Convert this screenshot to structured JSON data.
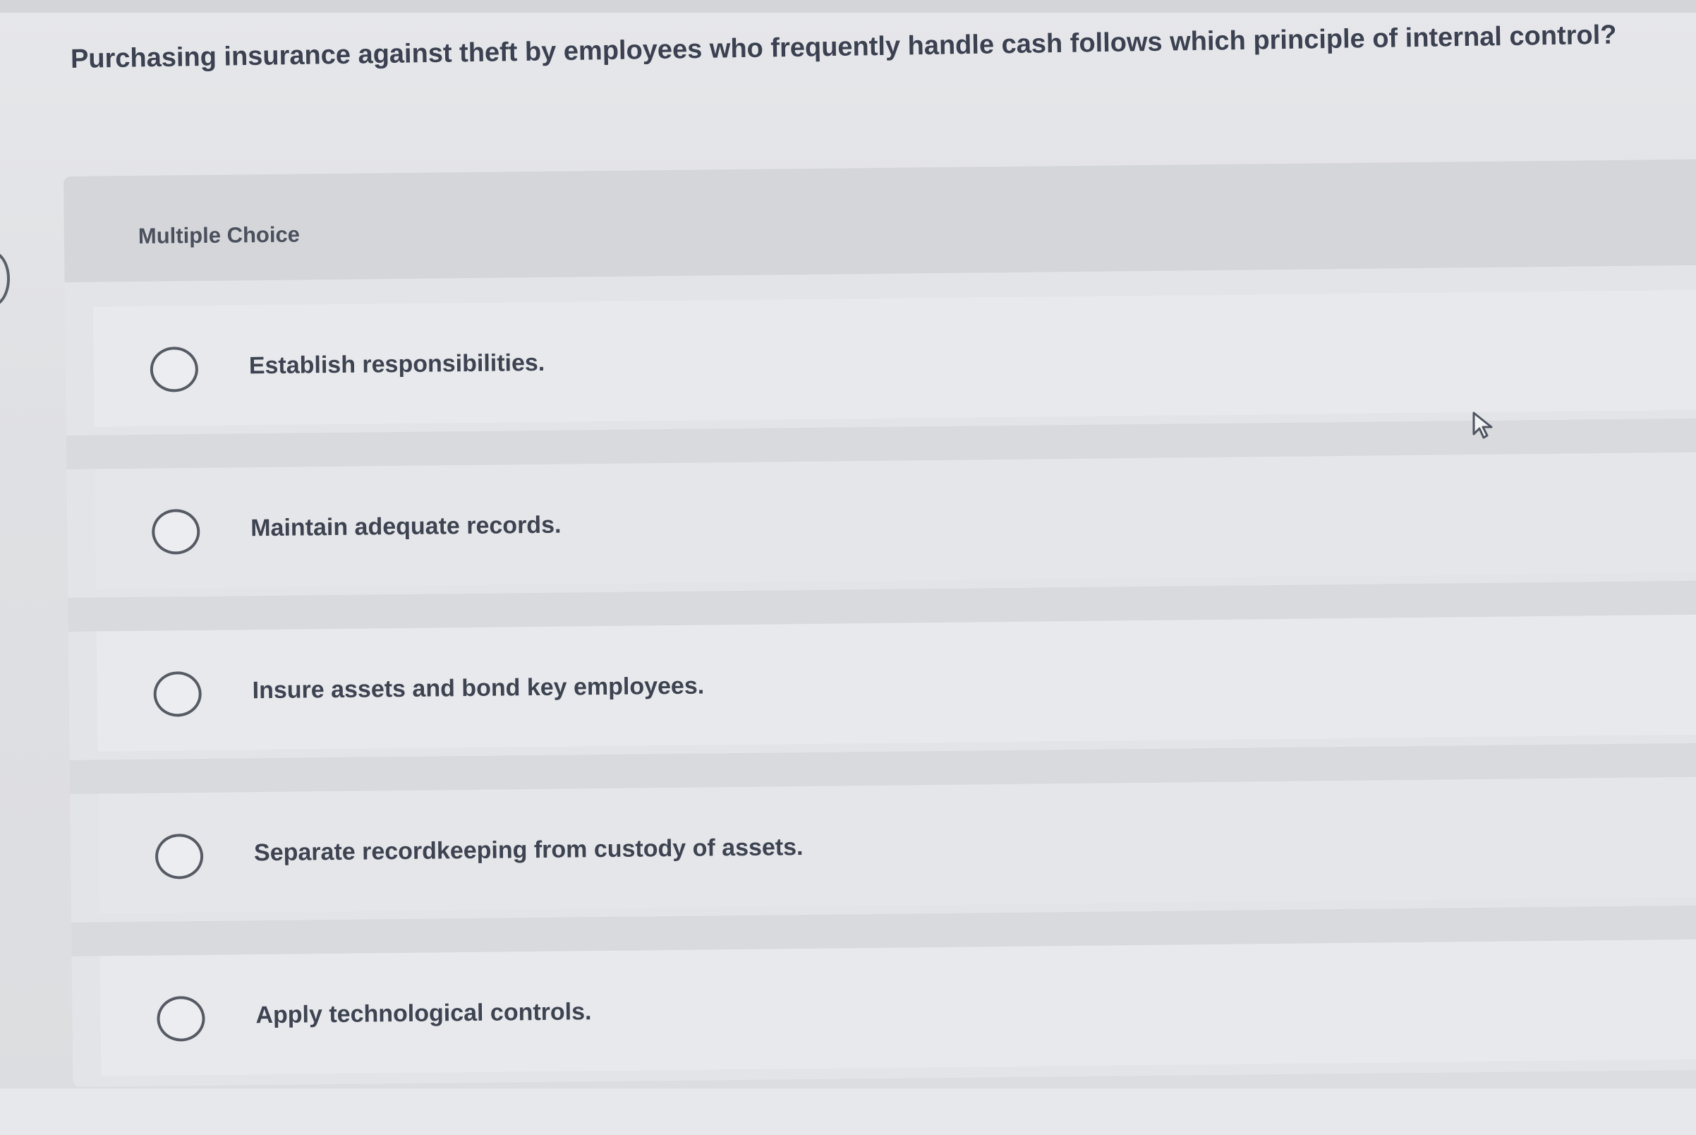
{
  "question": {
    "text": "Purchasing insurance against theft by employees who frequently handle cash follows which principle of internal control?"
  },
  "question_type": {
    "label": "Multiple Choice"
  },
  "choices": [
    {
      "label": "Establish responsibilities."
    },
    {
      "label": "Maintain adequate records."
    },
    {
      "label": "Insure assets and bond key employees."
    },
    {
      "label": "Separate recordkeeping from custody of assets."
    },
    {
      "label": "Apply technological controls."
    }
  ],
  "icons": {
    "radio": "radio-unselected-icon",
    "cursor": "mouse-pointer-icon"
  },
  "colors": {
    "text": "#3b4150",
    "card": "#e3e4e7",
    "header": "#d5d6da",
    "radio_border": "#555a63"
  }
}
